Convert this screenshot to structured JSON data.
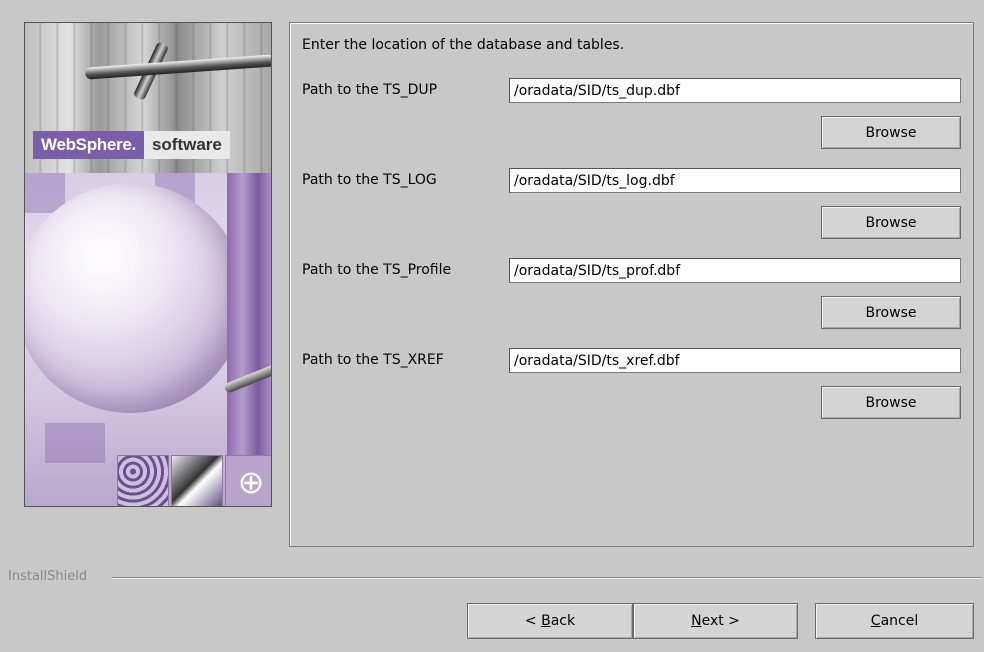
{
  "banner": {
    "logo_primary": "WebSphere.",
    "logo_secondary": "software",
    "accent_color": "#7a5ea8"
  },
  "panel": {
    "instruction": "Enter the location of the database and tables.",
    "fields": [
      {
        "label": "Path to the TS_DUP",
        "value": "/oradata/SID/ts_dup.dbf",
        "browse_label": "Browse"
      },
      {
        "label": "Path to the TS_LOG",
        "value": "/oradata/SID/ts_log.dbf",
        "browse_label": "Browse"
      },
      {
        "label": "Path to the TS_Profile",
        "value": "/oradata/SID/ts_prof.dbf",
        "browse_label": "Browse"
      },
      {
        "label": "Path to the TS_XREF",
        "value": "/oradata/SID/ts_xref.dbf",
        "browse_label": "Browse"
      }
    ]
  },
  "footer": {
    "brand": "InstallShield",
    "back": {
      "prefix": "< ",
      "mnemonic": "B",
      "rest": "ack"
    },
    "next": {
      "mnemonic": "N",
      "rest": "ext >"
    },
    "cancel": {
      "mnemonic": "C",
      "rest": "ancel"
    }
  },
  "icons": {
    "globe_symbol": "⊕"
  }
}
